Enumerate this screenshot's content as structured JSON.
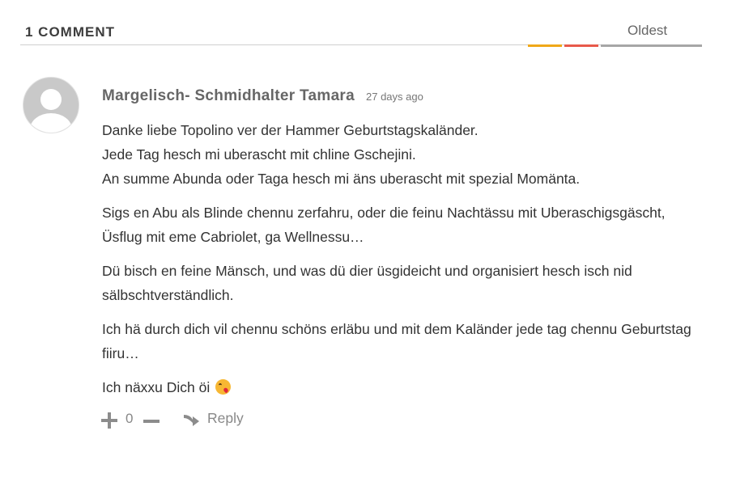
{
  "comments_header": {
    "count_label": "1 COMMENT",
    "sort_active_label": "Oldest"
  },
  "comment": {
    "author": "Margelisch- Schmidhalter Tamara",
    "timestamp": "27 days ago",
    "paragraphs": [
      {
        "lines": [
          "Danke liebe Topolino ver der Hammer Geburtstagskaländer.",
          "Jede Tag hesch mi uberascht mit chline Gschejini.",
          "An summe Abunda oder Taga hesch mi äns uberascht mit spezial Momänta."
        ]
      },
      {
        "text": "Sigs en Abu als Blinde chennu zerfahru, oder die feinu Nachtässu mit Uberaschigsgäscht, Üsflug mit eme Cabriolet, ga Wellnessu…"
      },
      {
        "text": "Dü bisch en feine Mänsch, und was dü dier üsgideicht und organisiert hesch isch nid sälbschtverständlich."
      },
      {
        "text": "Ich hä durch dich vil chennu schöns erläbu und mit dem Kaländer jede tag chennu Geburtstag fiiru…"
      },
      {
        "text": "Ich näxxu Dich öi",
        "emoji": "kissing-face-heart-emoji"
      }
    ],
    "votes": "0",
    "reply_label": "Reply"
  },
  "colors": {
    "accent_yellow": "#f0a818",
    "accent_red": "#e8594a",
    "avatar_gray": "#c9c9c9",
    "meta_gray": "#666666",
    "text": "#333333"
  }
}
